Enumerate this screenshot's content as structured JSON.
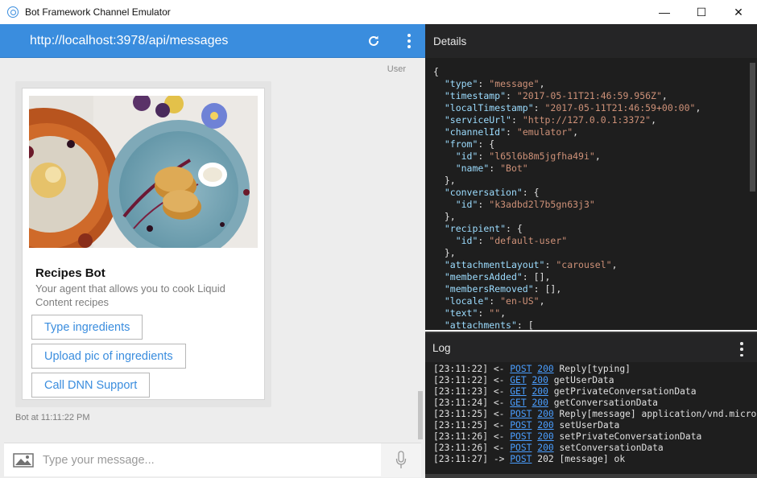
{
  "window": {
    "title": "Bot Framework Channel Emulator",
    "minimize": "—",
    "maximize": "☐",
    "close": "✕"
  },
  "chat": {
    "url": "http://localhost:3978/api/messages",
    "user_label": "User",
    "card": {
      "title": "Recipes Bot",
      "subtitle": "Your agent that allows you to cook Liquid Content recipes",
      "buttons": [
        "Type ingredients",
        "Upload pic of ingredients",
        "Call DNN Support"
      ]
    },
    "timestamp": "Bot at 11:11:22 PM",
    "input_placeholder": "Type your message..."
  },
  "details": {
    "title": "Details",
    "json_lines": [
      [
        {
          "t": "p",
          "v": "{"
        }
      ],
      [
        {
          "t": "p",
          "v": "  "
        },
        {
          "t": "k",
          "v": "\"type\""
        },
        {
          "t": "p",
          "v": ": "
        },
        {
          "t": "s",
          "v": "\"message\""
        },
        {
          "t": "p",
          "v": ","
        }
      ],
      [
        {
          "t": "p",
          "v": "  "
        },
        {
          "t": "k",
          "v": "\"timestamp\""
        },
        {
          "t": "p",
          "v": ": "
        },
        {
          "t": "s",
          "v": "\"2017-05-11T21:46:59.956Z\""
        },
        {
          "t": "p",
          "v": ","
        }
      ],
      [
        {
          "t": "p",
          "v": "  "
        },
        {
          "t": "k",
          "v": "\"localTimestamp\""
        },
        {
          "t": "p",
          "v": ": "
        },
        {
          "t": "s",
          "v": "\"2017-05-11T21:46:59+00:00\""
        },
        {
          "t": "p",
          "v": ","
        }
      ],
      [
        {
          "t": "p",
          "v": "  "
        },
        {
          "t": "k",
          "v": "\"serviceUrl\""
        },
        {
          "t": "p",
          "v": ": "
        },
        {
          "t": "s",
          "v": "\"http://127.0.0.1:3372\""
        },
        {
          "t": "p",
          "v": ","
        }
      ],
      [
        {
          "t": "p",
          "v": "  "
        },
        {
          "t": "k",
          "v": "\"channelId\""
        },
        {
          "t": "p",
          "v": ": "
        },
        {
          "t": "s",
          "v": "\"emulator\""
        },
        {
          "t": "p",
          "v": ","
        }
      ],
      [
        {
          "t": "p",
          "v": "  "
        },
        {
          "t": "k",
          "v": "\"from\""
        },
        {
          "t": "p",
          "v": ": {"
        }
      ],
      [
        {
          "t": "p",
          "v": "    "
        },
        {
          "t": "k",
          "v": "\"id\""
        },
        {
          "t": "p",
          "v": ": "
        },
        {
          "t": "s",
          "v": "\"l65l6b8m5jgfha49i\""
        },
        {
          "t": "p",
          "v": ","
        }
      ],
      [
        {
          "t": "p",
          "v": "    "
        },
        {
          "t": "k",
          "v": "\"name\""
        },
        {
          "t": "p",
          "v": ": "
        },
        {
          "t": "s",
          "v": "\"Bot\""
        }
      ],
      [
        {
          "t": "p",
          "v": "  },"
        }
      ],
      [
        {
          "t": "p",
          "v": "  "
        },
        {
          "t": "k",
          "v": "\"conversation\""
        },
        {
          "t": "p",
          "v": ": {"
        }
      ],
      [
        {
          "t": "p",
          "v": "    "
        },
        {
          "t": "k",
          "v": "\"id\""
        },
        {
          "t": "p",
          "v": ": "
        },
        {
          "t": "s",
          "v": "\"k3adbd2l7b5gn63j3\""
        }
      ],
      [
        {
          "t": "p",
          "v": "  },"
        }
      ],
      [
        {
          "t": "p",
          "v": "  "
        },
        {
          "t": "k",
          "v": "\"recipient\""
        },
        {
          "t": "p",
          "v": ": {"
        }
      ],
      [
        {
          "t": "p",
          "v": "    "
        },
        {
          "t": "k",
          "v": "\"id\""
        },
        {
          "t": "p",
          "v": ": "
        },
        {
          "t": "s",
          "v": "\"default-user\""
        }
      ],
      [
        {
          "t": "p",
          "v": "  },"
        }
      ],
      [
        {
          "t": "p",
          "v": "  "
        },
        {
          "t": "k",
          "v": "\"attachmentLayout\""
        },
        {
          "t": "p",
          "v": ": "
        },
        {
          "t": "s",
          "v": "\"carousel\""
        },
        {
          "t": "p",
          "v": ","
        }
      ],
      [
        {
          "t": "p",
          "v": "  "
        },
        {
          "t": "k",
          "v": "\"membersAdded\""
        },
        {
          "t": "p",
          "v": ": [],"
        }
      ],
      [
        {
          "t": "p",
          "v": "  "
        },
        {
          "t": "k",
          "v": "\"membersRemoved\""
        },
        {
          "t": "p",
          "v": ": [],"
        }
      ],
      [
        {
          "t": "p",
          "v": "  "
        },
        {
          "t": "k",
          "v": "\"locale\""
        },
        {
          "t": "p",
          "v": ": "
        },
        {
          "t": "s",
          "v": "\"en-US\""
        },
        {
          "t": "p",
          "v": ","
        }
      ],
      [
        {
          "t": "p",
          "v": "  "
        },
        {
          "t": "k",
          "v": "\"text\""
        },
        {
          "t": "p",
          "v": ": "
        },
        {
          "t": "s",
          "v": "\"\""
        },
        {
          "t": "p",
          "v": ","
        }
      ],
      [
        {
          "t": "p",
          "v": "  "
        },
        {
          "t": "k",
          "v": "\"attachments\""
        },
        {
          "t": "p",
          "v": ": ["
        }
      ]
    ]
  },
  "log": {
    "title": "Log",
    "lines": [
      {
        "time": "[23:11:22]",
        "dir": "<-",
        "method": "POST",
        "status": "200",
        "status_link": true,
        "text": "Reply[typing]"
      },
      {
        "time": "[23:11:22]",
        "dir": "<-",
        "method": "GET",
        "status": "200",
        "status_link": true,
        "text": "getUserData"
      },
      {
        "time": "[23:11:23]",
        "dir": "<-",
        "method": "GET",
        "status": "200",
        "status_link": true,
        "text": "getPrivateConversationData"
      },
      {
        "time": "[23:11:24]",
        "dir": "<-",
        "method": "GET",
        "status": "200",
        "status_link": true,
        "text": "getConversationData"
      },
      {
        "time": "[23:11:25]",
        "dir": "<-",
        "method": "POST",
        "status": "200",
        "status_link": true,
        "text": "Reply[message] application/vnd.micros"
      },
      {
        "time": "[23:11:25]",
        "dir": "<-",
        "method": "POST",
        "status": "200",
        "status_link": true,
        "text": "setUserData"
      },
      {
        "time": "[23:11:26]",
        "dir": "<-",
        "method": "POST",
        "status": "200",
        "status_link": true,
        "text": "setPrivateConversationData"
      },
      {
        "time": "[23:11:26]",
        "dir": "<-",
        "method": "POST",
        "status": "200",
        "status_link": true,
        "text": "setConversationData"
      },
      {
        "time": "[23:11:27]",
        "dir": "->",
        "method": "POST",
        "status": "202",
        "status_link": false,
        "text": "[message] ok"
      }
    ]
  },
  "colors": {
    "accent": "#3a8dde",
    "panel_dark": "#1e1e1e",
    "header_dark": "#252526"
  }
}
